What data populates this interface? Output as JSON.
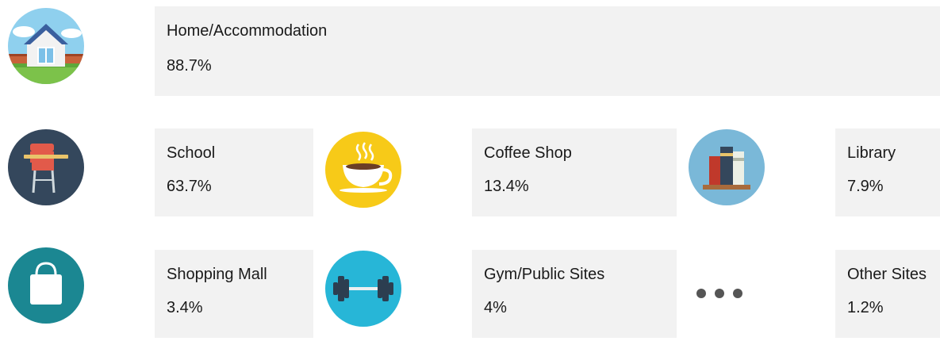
{
  "chart_data": {
    "type": "table",
    "title": "",
    "categories": [
      "Home/Accommodation",
      "School",
      "Coffee Shop",
      "Library",
      "Shopping Mall",
      "Gym/Public Sites",
      "Other Sites"
    ],
    "values": [
      88.7,
      63.7,
      13.4,
      7.9,
      3.4,
      4,
      1.2
    ],
    "labels": [
      "88.7%",
      "63.7%",
      "13.4%",
      "7.9%",
      "3.4%",
      "4%",
      "1.2%"
    ]
  },
  "items": [
    {
      "name": "Home/Accommodation",
      "value": "88.7%",
      "icon": "house-icon"
    },
    {
      "name": "School",
      "value": "63.7%",
      "icon": "school-chair-icon"
    },
    {
      "name": "Coffee Shop",
      "value": "13.4%",
      "icon": "coffee-cup-icon"
    },
    {
      "name": "Library",
      "value": "7.9%",
      "icon": "books-icon"
    },
    {
      "name": "Shopping Mall",
      "value": "3.4%",
      "icon": "shopping-bag-icon"
    },
    {
      "name": "Gym/Public Sites",
      "value": "4%",
      "icon": "dumbbell-icon"
    },
    {
      "name": "Other Sites",
      "value": "1.2%",
      "icon": "more-dots-icon"
    }
  ],
  "colors": {
    "card_bg": "#f2f2f2",
    "school_circle": "#34475c",
    "coffee_circle": "#f7ca18",
    "library_circle": "#7ab8d8",
    "mall_circle": "#1b8792",
    "gym_circle": "#27b6d7",
    "dots": "#555555"
  }
}
